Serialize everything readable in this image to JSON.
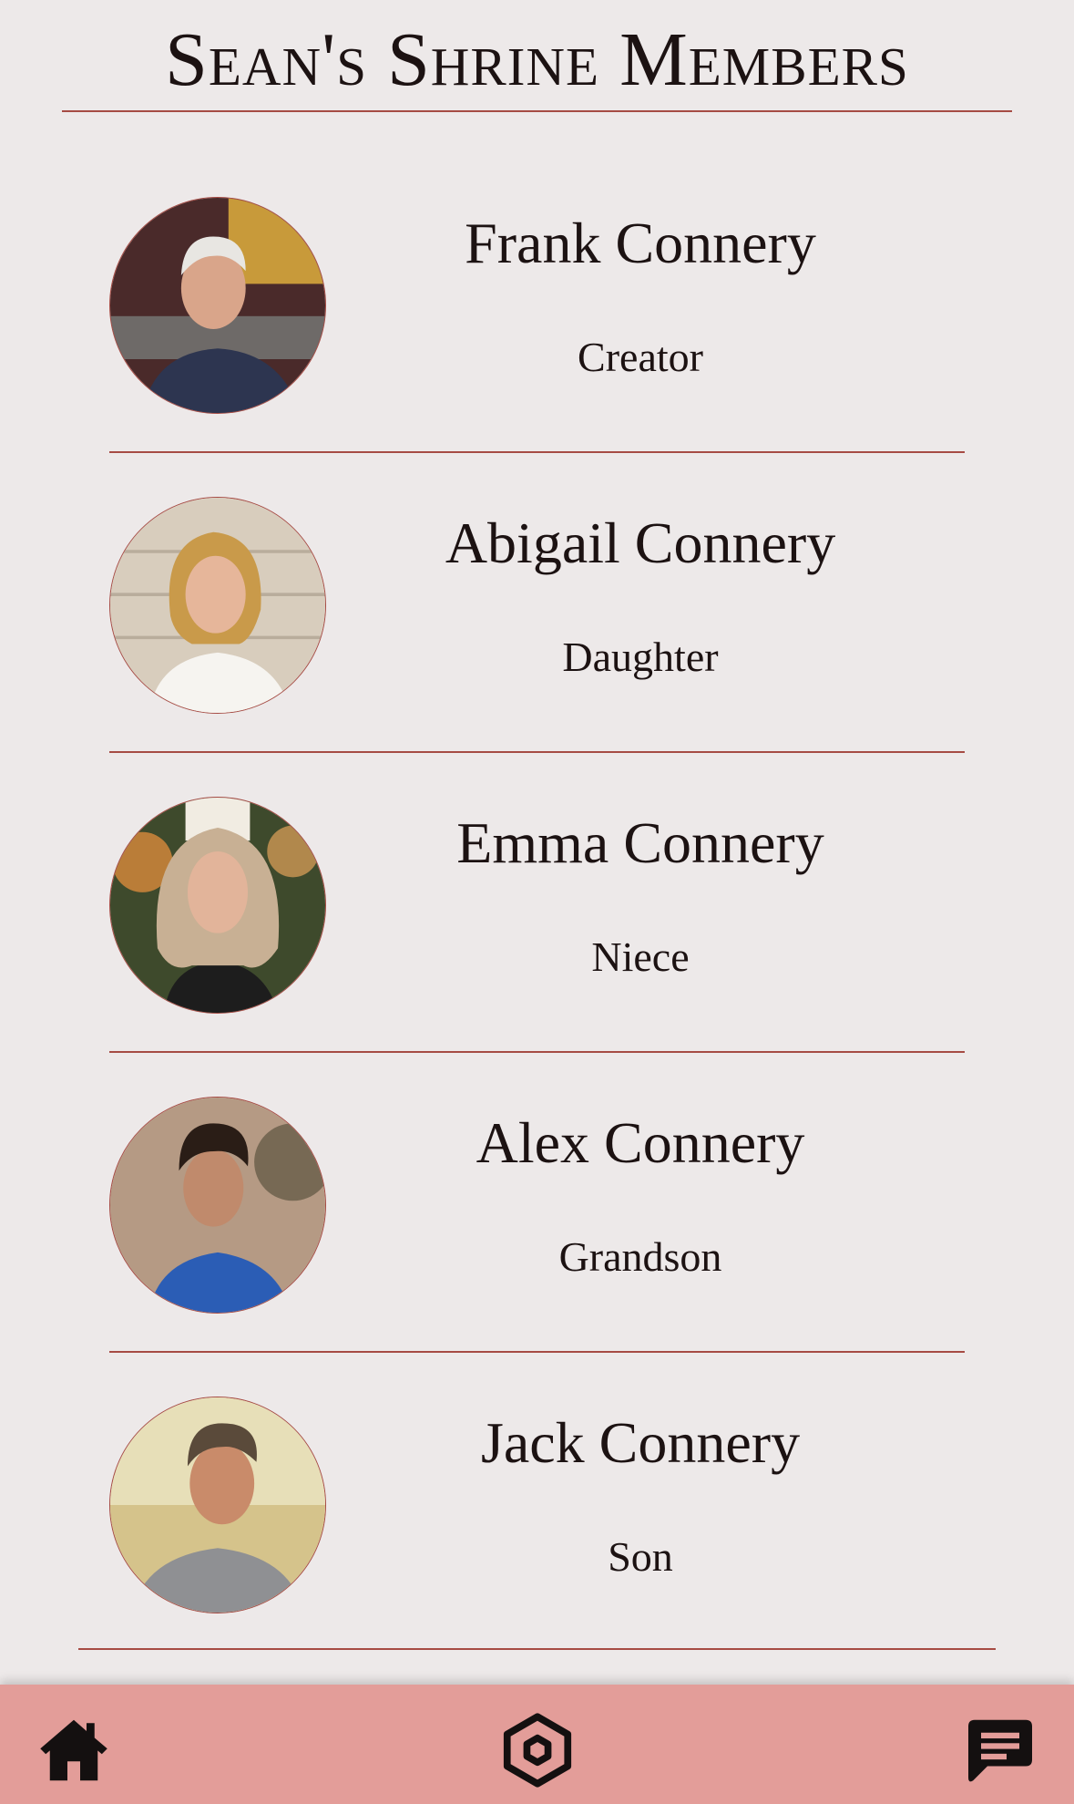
{
  "header": {
    "title": "Sean's Shrine Members"
  },
  "members": [
    {
      "name": "Frank Connery",
      "role": "Creator"
    },
    {
      "name": "Abigail Connery",
      "role": "Daughter"
    },
    {
      "name": "Emma Connery",
      "role": "Niece"
    },
    {
      "name": "Alex Connery",
      "role": "Grandson"
    },
    {
      "name": "Jack Connery",
      "role": "Son"
    }
  ],
  "navbar": {
    "items": [
      {
        "icon": "home-icon"
      },
      {
        "icon": "hexagon-icon"
      },
      {
        "icon": "chat-icon"
      }
    ]
  },
  "colors": {
    "background": "#ede9e9",
    "accent": "#a64b44",
    "navbar": "#e39d99",
    "text": "#1c1212"
  }
}
